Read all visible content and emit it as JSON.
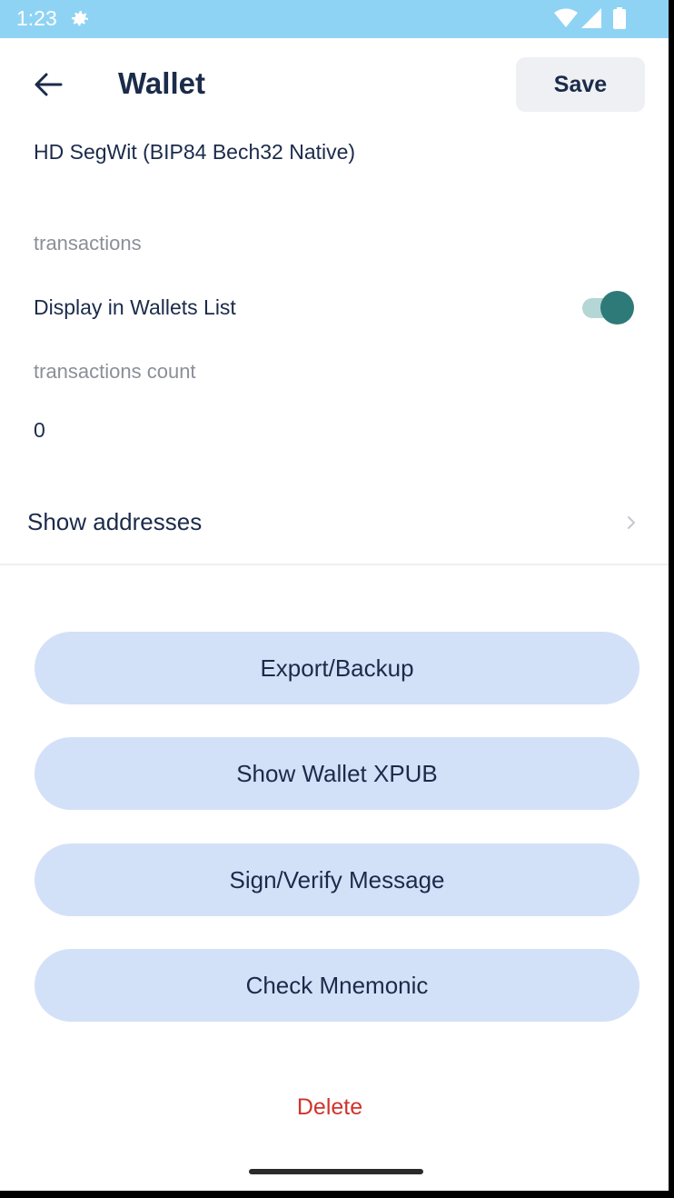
{
  "status_bar": {
    "time": "1:23",
    "bg_color": "#8fd3f4",
    "icons": [
      "gear-icon",
      "wifi-icon",
      "signal-icon",
      "battery-icon"
    ]
  },
  "header": {
    "back_icon": "arrow-left-icon",
    "title": "Wallet",
    "save_label": "Save"
  },
  "wallet": {
    "type": "HD SegWit (BIP84 Bech32 Native)",
    "transactions_label": "transactions",
    "display_in_list_label": "Display in Wallets List",
    "display_in_list_enabled": true,
    "transactions_count_label": "transactions count",
    "transactions_count": "0"
  },
  "show_addresses": {
    "label": "Show addresses",
    "icon": "chevron-right-icon"
  },
  "actions": [
    {
      "label": "Export/Backup"
    },
    {
      "label": "Show Wallet XPUB"
    },
    {
      "label": "Sign/Verify Message"
    },
    {
      "label": "Check Mnemonic"
    }
  ],
  "delete_label": "Delete",
  "colors": {
    "accent": "#2e7a78",
    "button_bg": "#d3e1f8",
    "text_primary": "#1b2b4a",
    "danger": "#d0342c"
  }
}
